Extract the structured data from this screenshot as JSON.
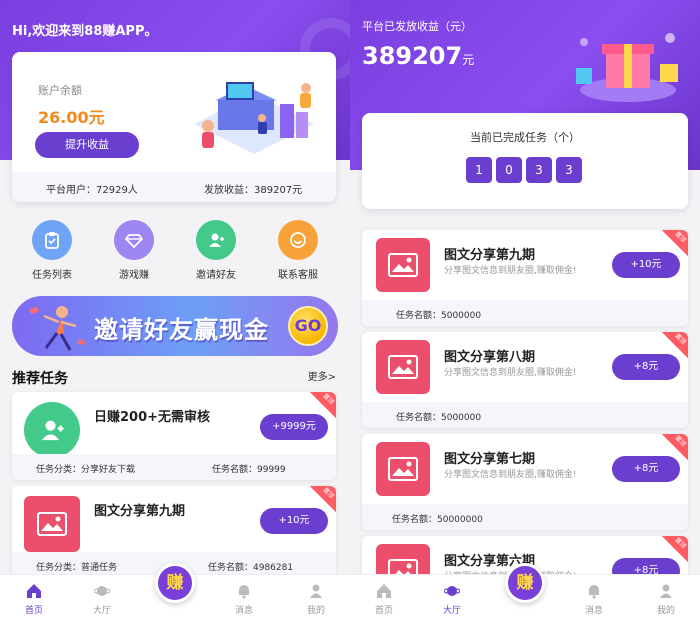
{
  "home": {
    "welcome": "Hi,欢迎来到88赚APP。",
    "balance": {
      "label": "账户余额",
      "amount": "26.00元",
      "lift_button": "提升收益",
      "platform_users": "平台用户：72929人",
      "paid_earnings": "发放收益：389207元"
    },
    "quick_links": [
      {
        "label": "任务列表",
        "icon": "clipboard-icon",
        "color": "#6fa4f7"
      },
      {
        "label": "游戏赚",
        "icon": "diamond-icon",
        "color": "#9d86f2"
      },
      {
        "label": "邀请好友",
        "icon": "add-user-icon",
        "color": "#43c98a"
      },
      {
        "label": "联系客服",
        "icon": "smile-icon",
        "color": "#f8a33a"
      }
    ],
    "banner": {
      "text": "邀请好友赢现金",
      "badge": "GO"
    },
    "recommend": {
      "title": "推荐任务",
      "more": "更多>"
    },
    "tasks": [
      {
        "title": "日赚200+无需审核",
        "reward": "+9999元",
        "category": "任务分类：分享好友下载",
        "amount": "任务名额：99999",
        "corner": "置顶",
        "icon": "add-user-icon",
        "color": "#43c98a"
      },
      {
        "title": "图文分享第九期",
        "reward": "+10元",
        "category": "任务分类：普通任务",
        "amount": "任务名额：4986281",
        "corner": "置顶",
        "icon": "picture-icon",
        "color": "#ec4f6b"
      }
    ]
  },
  "hall": {
    "label": "平台已发放收益（元）",
    "amount": "389207",
    "unit": "元",
    "counter_label": "当前已完成任务（个）",
    "digits": [
      "1",
      "0",
      "3",
      "3"
    ],
    "tasks": [
      {
        "title": "图文分享第九期",
        "desc": "分享图文信息到朋友圈,赚取佣金!",
        "reward": "+10元",
        "amount": "任务名额：5000000",
        "corner": "置顶"
      },
      {
        "title": "图文分享第八期",
        "desc": "分享图文信息到朋友圈,赚取佣金!",
        "reward": "+8元",
        "amount": "任务名额：5000000",
        "corner": "置顶"
      },
      {
        "title": "图文分享第七期",
        "desc": "分享图文信息到朋友圈,赚取佣金!",
        "reward": "+8元",
        "amount": "任务名额：50000000",
        "corner": "置顶"
      },
      {
        "title": "图文分享第六期",
        "desc": "分享图文信息到朋友圈,赚取佣金!",
        "reward": "+8元",
        "amount": "",
        "corner": "置顶"
      }
    ]
  },
  "tabbar": {
    "home": "首页",
    "hall": "大厅",
    "earn": "赚",
    "messages": "消息",
    "mine": "我的"
  },
  "colors": {
    "brand": "#6a3fd0",
    "orange": "#f08a1f",
    "task_red": "#ec4f6b"
  }
}
